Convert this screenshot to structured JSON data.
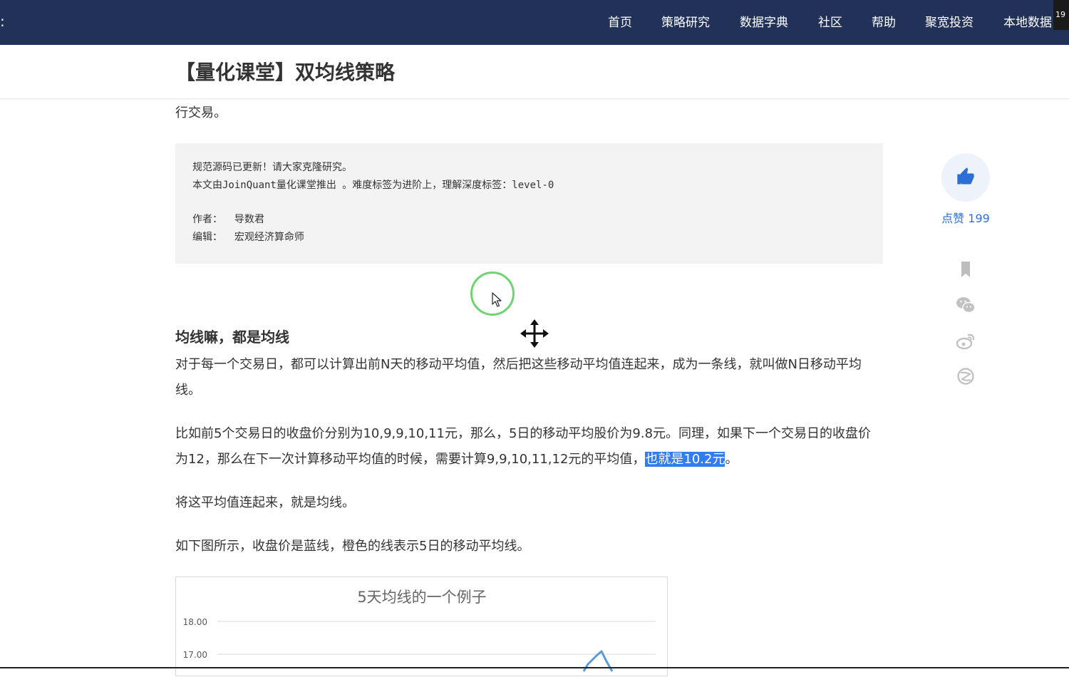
{
  "nav": {
    "edge_glyph": ":",
    "items": [
      "首页",
      "策略研究",
      "数据字典",
      "社区",
      "帮助",
      "聚宽投资",
      "本地数据"
    ],
    "badge": "19"
  },
  "article": {
    "title": "【量化课堂】双均线策略",
    "lead_fragment": "行交易。",
    "notice": {
      "line1": "规范源码已更新！请大家克隆研究。",
      "line2": "本文由JoinQuant量化课堂推出 。难度标签为进阶上，理解深度标签：level-0",
      "author": "作者：  导数君",
      "editor": "编辑：  宏观经济算命师"
    },
    "section_heading": "均线嘛，都是均线",
    "p1": "对于每一个交易日，都可以计算出前N天的移动平均值，然后把这些移动平均值连起来，成为一条线，就叫做N日移动平均线。",
    "p2_before": "比如前5个交易日的收盘价分别为10,9,9,10,11元，那么，5日的移动平均股价为9.8元。同理，如果下一个交易日的收盘价为12，那么在下一次计算移动平均值的时候，需要计算9,9,10,11,12元的平均值，",
    "p2_selected": "也就是10.2元",
    "p2_after": "。",
    "p3": "将这平均值连起来，就是均线。",
    "p4": "如下图所示，收盘价是蓝线，橙色的线表示5日的移动平均线。"
  },
  "sidebar": {
    "like_label": "点赞 199"
  },
  "chart_data": {
    "type": "line",
    "title": "5天均线的一个例子",
    "y_ticks": [
      "18.00",
      "17.00"
    ],
    "grid": true,
    "series_colors": [
      "#5b9bd5"
    ]
  },
  "colors": {
    "nav_bg": "#213158",
    "accent": "#2b6fd6",
    "selection": "#2f7df0"
  }
}
